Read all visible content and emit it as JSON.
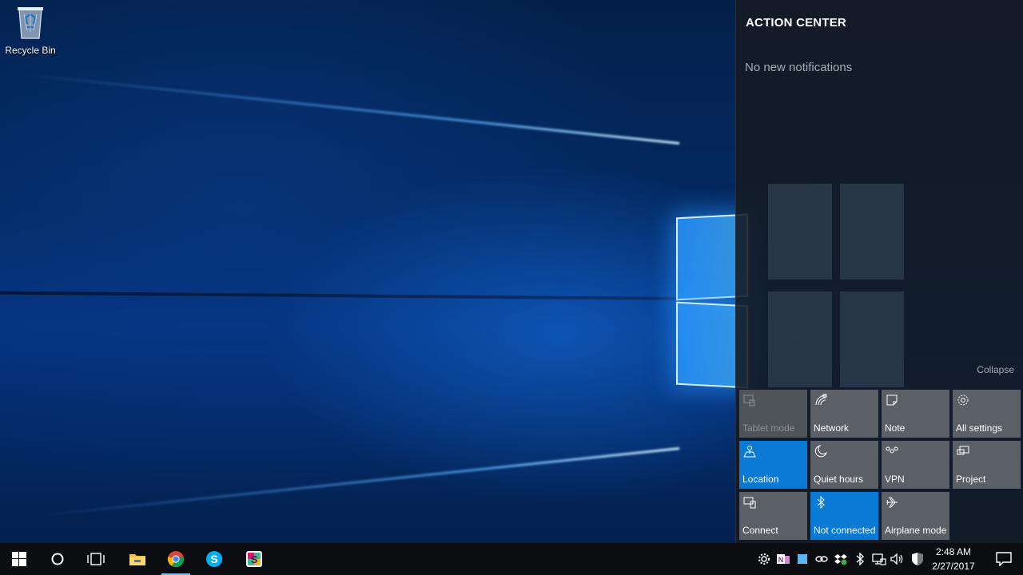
{
  "desktop": {
    "icons": [
      {
        "label": "Recycle Bin",
        "icon": "recycle-bin-icon"
      }
    ]
  },
  "action_center": {
    "title": "ACTION CENTER",
    "empty_message": "No new notifications",
    "collapse_label": "Collapse",
    "quick_actions": [
      {
        "label": "Tablet mode",
        "icon": "tablet-mode-icon",
        "state": "off-dim"
      },
      {
        "label": "Network",
        "icon": "network-icon",
        "state": "off"
      },
      {
        "label": "Note",
        "icon": "note-icon",
        "state": "off"
      },
      {
        "label": "All settings",
        "icon": "gear-icon",
        "state": "off"
      },
      {
        "label": "Location",
        "icon": "location-icon",
        "state": "on"
      },
      {
        "label": "Quiet hours",
        "icon": "moon-icon",
        "state": "off"
      },
      {
        "label": "VPN",
        "icon": "vpn-icon",
        "state": "off"
      },
      {
        "label": "Project",
        "icon": "project-icon",
        "state": "off"
      },
      {
        "label": "Connect",
        "icon": "connect-icon",
        "state": "off"
      },
      {
        "label": "Not connected",
        "icon": "bluetooth-icon",
        "state": "on"
      },
      {
        "label": "Airplane mode",
        "icon": "airplane-icon",
        "state": "off"
      }
    ]
  },
  "taskbar": {
    "buttons": [
      {
        "icon": "windows-start-icon"
      },
      {
        "icon": "cortana-search-icon"
      },
      {
        "icon": "task-view-icon"
      },
      {
        "icon": "file-explorer-icon"
      },
      {
        "icon": "chrome-icon",
        "active": true
      },
      {
        "icon": "skype-icon"
      },
      {
        "icon": "slack-icon"
      }
    ],
    "tray_icons": [
      "settings-gear-tray-icon",
      "onenote-tray-icon",
      "blue-square-tray-icon",
      "link-tray-icon",
      "dropbox-tray-icon",
      "bluetooth-tray-icon",
      "network-tray-icon",
      "volume-tray-icon",
      "security-shield-tray-icon"
    ],
    "clock": {
      "time": "2:48 AM",
      "date": "2/27/2017"
    },
    "notification_icon": "action-center-icon"
  },
  "colors": {
    "accent": "#0b7ad4",
    "tile_off": "#5b6066",
    "taskbar": "#0b0d10",
    "panel": "#141a22"
  }
}
